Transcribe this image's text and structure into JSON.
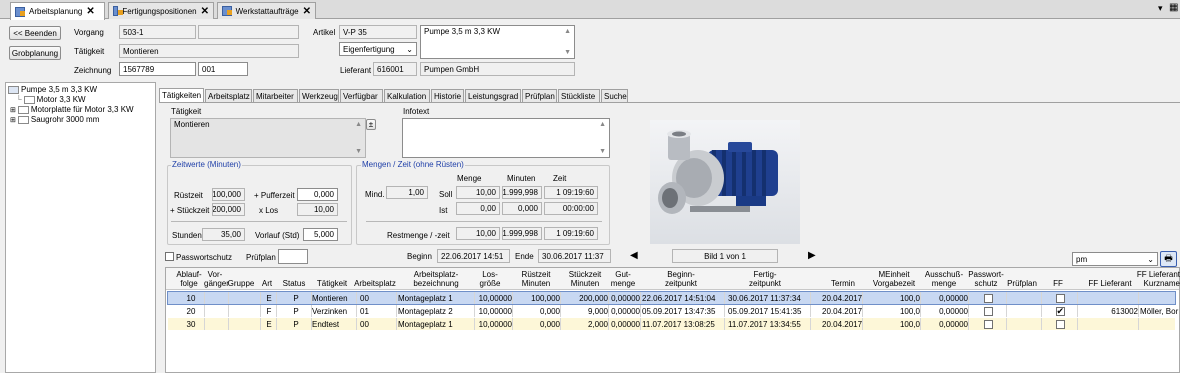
{
  "tabs": [
    {
      "label": "Arbeitsplanung",
      "active": true
    },
    {
      "label": "Fertigungspositionen",
      "active": false
    },
    {
      "label": "Werkstattaufträge",
      "active": false
    }
  ],
  "header": {
    "back_label": "<< Beenden",
    "grob_label": "Grobplanung",
    "vorgang_label": "Vorgang",
    "vorgang_value": "503-1",
    "taetigkeit_label": "Tätigkeit",
    "taetigkeit_value": "Montieren",
    "zeichnung_label": "Zeichnung",
    "zeichnung_value": "1567789",
    "zeichnung_index": "001",
    "artikel_label": "Artikel",
    "artikel_value": "V-P 35",
    "artikel_desc": "Pumpe 3,5 m 3,3 KW",
    "fertigung_select": "Eigenfertigung",
    "lieferant_label": "Lieferant",
    "lieferant_nr": "616001",
    "lieferant_name": "Pumpen GmbH"
  },
  "tree": [
    {
      "label": "Pumpe 3,5 m 3,3 KW",
      "level": 0
    },
    {
      "label": "Motor 3,3 KW",
      "level": 1
    },
    {
      "label": "Motorplatte für Motor 3,3 KW",
      "level": 1
    },
    {
      "label": "Saugrohr 3000 mm",
      "level": 1
    }
  ],
  "inner_tabs": [
    "Tätigkeiten",
    "Arbeitsplatz",
    "Mitarbeiter",
    "Werkzeug",
    "Verfügbar",
    "Kalkulation",
    "Historie",
    "Leistungsgrad",
    "Prüfplan",
    "Stückliste",
    "Suche"
  ],
  "detail": {
    "taetigkeit_label": "Tätigkeit",
    "taetigkeit_text": "Montieren",
    "infotext_label": "Infotext",
    "zeit_group": "Zeitwerte (Minuten)",
    "ruestzeit_label": "Rüstzeit",
    "ruestzeit_value": "100,000",
    "pufferzeit_label": "+ Pufferzeit",
    "pufferzeit_value": "0,000",
    "stueckzeit_label": "+ Stückzeit",
    "stueckzeit_value": "200,000",
    "xlos_label": "x Los",
    "xlos_value": "10,00",
    "stunden_label": "Stunden",
    "stunden_value": "35,00",
    "vorlauf_label": "Vorlauf (Std)",
    "vorlauf_value": "5,000",
    "mengen_group": "Mengen / Zeit (ohne Rüsten)",
    "col_menge": "Menge",
    "col_minuten": "Minuten",
    "col_zeit": "Zeit",
    "mind_label": "Mind.",
    "mind_value": "1,00",
    "soll_label": "Soll",
    "soll_menge": "10,00",
    "soll_minuten": "1.999,998",
    "soll_zeit": "1 09:19:60",
    "ist_label": "Ist",
    "ist_menge": "0,00",
    "ist_minuten": "0,000",
    "ist_zeit": "00:00:00",
    "rest_label": "Restmenge / -zeit",
    "rest_menge": "10,00",
    "rest_minuten": "1.999,998",
    "rest_zeit": "1 09:19:60",
    "passwort_label": "Passwortschutz",
    "pruefplan_label": "Prüfplan",
    "beginn_label": "Beginn",
    "beginn_value": "22.06.2017 14:51",
    "ende_label": "Ende",
    "ende_value": "30.06.2017 11:37",
    "bild_label": "Bild 1 von 1",
    "unit_select": "pm"
  },
  "table": {
    "headers": [
      "Ablauf-\nfolge",
      "Vor-\ngänger",
      "Gruppe",
      "Art",
      "Status",
      "Tätigkeit",
      "Arbeitsplatz",
      "Arbeitsplatz-\nbezeichnung",
      "Los-\ngröße",
      "Rüstzeit\nMinuten",
      "Stückzeit\nMinuten",
      "Gut-\nmenge",
      "Beginn-\nzeitpunkt",
      "Fertig-\nzeitpunkt",
      "Termin",
      "MEinheit\nVorgabezeit",
      "Ausschuß-\nmenge",
      "Passwort-\nschutz",
      "Prüfplan",
      "FF",
      "FF Lieferant",
      "FF Lieferant\nKurzname"
    ],
    "rows": [
      [
        "10",
        "",
        "",
        "E",
        "P",
        "Montieren",
        "00",
        "Montageplatz 1",
        "10,00000",
        "100,000",
        "200,000",
        "0,00000",
        "22.06.2017 14:51:04",
        "30.06.2017 11:37:34",
        "20.04.2017",
        "100,0",
        "0,00000",
        "",
        "",
        "",
        "",
        ""
      ],
      [
        "20",
        "",
        "",
        "F",
        "P",
        "Verzinken",
        "01",
        "Montageplatz 2",
        "10,00000",
        "0,000",
        "9,000",
        "0,00000",
        "05.09.2017 13:47:35",
        "05.09.2017 15:41:35",
        "20.04.2017",
        "100,0",
        "0,00000",
        "",
        "",
        "",
        "613002",
        "Möller, Bor"
      ],
      [
        "30",
        "",
        "",
        "E",
        "P",
        "Endtest",
        "00",
        "Montageplatz 1",
        "10,00000",
        "0,000",
        "2,000",
        "0,00000",
        "11.07.2017 13:08:25",
        "11.07.2017 13:34:55",
        "20.04.2017",
        "100,0",
        "0,00000",
        "",
        "",
        "",
        "",
        ""
      ]
    ],
    "ff_checked": [
      false,
      true,
      false
    ]
  }
}
